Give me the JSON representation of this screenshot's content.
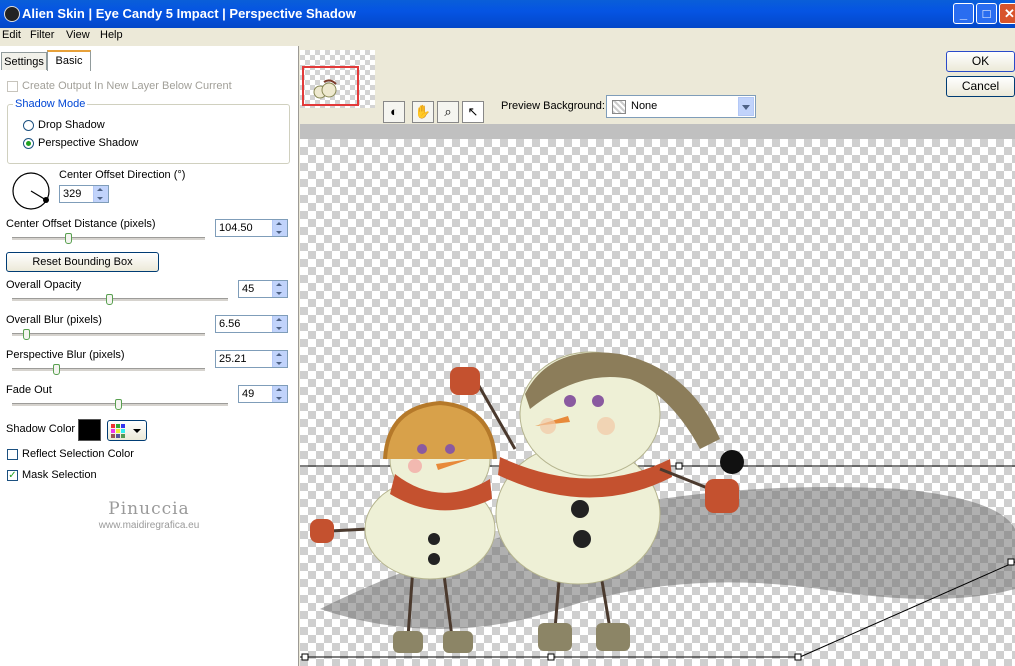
{
  "window": {
    "title": "Alien Skin  |  Eye Candy 5 Impact  |  Perspective Shadow"
  },
  "menu": [
    "Edit",
    "Filter",
    "View",
    "Help"
  ],
  "tabs": [
    "Settings",
    "Basic"
  ],
  "options": {
    "create_output": "Create Output In New Layer Below Current",
    "shadow_mode_title": "Shadow Mode",
    "drop_shadow": "Drop Shadow",
    "perspective_shadow": "Perspective Shadow",
    "center_offset_direction_label": "Center Offset Direction (°)",
    "center_offset_direction_value": "329",
    "center_offset_distance_label": "Center Offset Distance (pixels)",
    "center_offset_distance_value": "104.50",
    "reset_bounding_box": "Reset Bounding Box",
    "overall_opacity_label": "Overall Opacity",
    "overall_opacity_value": "45",
    "overall_blur_label": "Overall Blur (pixels)",
    "overall_blur_value": "6.56",
    "perspective_blur_label": "Perspective Blur (pixels)",
    "perspective_blur_value": "25.21",
    "fade_out_label": "Fade Out",
    "fade_out_value": "49",
    "shadow_color_label": "Shadow Color",
    "reflect_selection_color": "Reflect Selection Color",
    "mask_selection": "Mask Selection"
  },
  "sliders": {
    "distance": 0.29,
    "opacity": 0.45,
    "blur": 0.07,
    "persp_blur": 0.23,
    "fade": 0.49
  },
  "colors": {
    "shadow": "#000000",
    "accent": "#0046d5"
  },
  "watermark": {
    "name": "Pinuccia",
    "url": "www.maidiregrafica.eu"
  },
  "buttons": {
    "ok": "OK",
    "cancel": "Cancel"
  },
  "preview": {
    "background_label": "Preview Background:",
    "background_value": "None"
  }
}
